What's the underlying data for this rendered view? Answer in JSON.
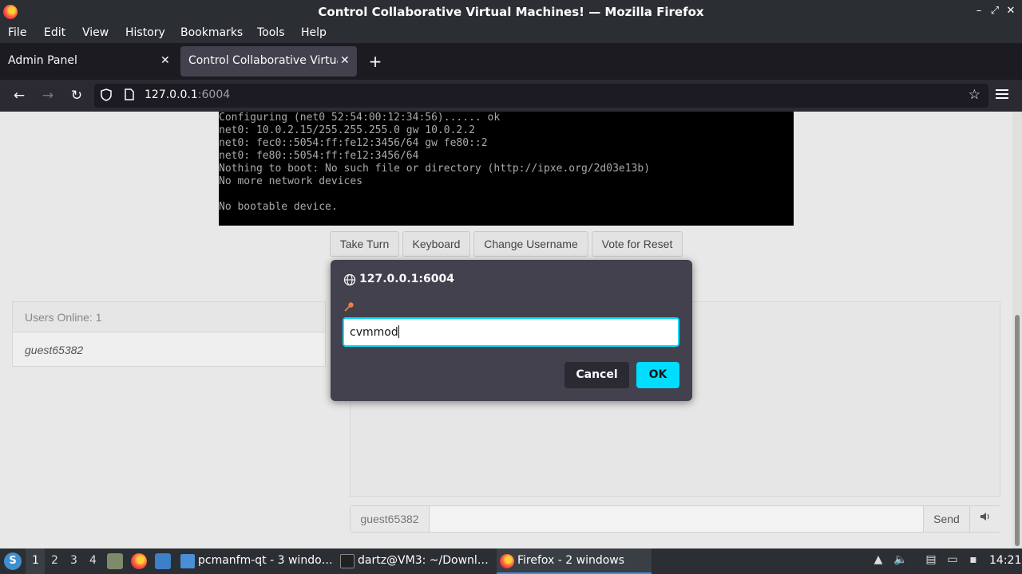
{
  "window": {
    "title": "Control Collaborative Virtual Machines! — Mozilla Firefox",
    "minimize_glyph": "–",
    "maximize_glyph": "⤢",
    "close_glyph": "✕"
  },
  "menu": {
    "items": [
      "File",
      "Edit",
      "View",
      "History",
      "Bookmarks",
      "Tools",
      "Help"
    ]
  },
  "tabs": [
    {
      "label": "Admin Panel",
      "active": false
    },
    {
      "label": "Control Collaborative Virtual Machines!",
      "active": true
    }
  ],
  "tab_close_glyph": "✕",
  "new_tab_glyph": "+",
  "nav": {
    "back_glyph": "←",
    "forward_glyph": "→",
    "reload_glyph": "↻",
    "url_host": "127.0.0.1",
    "url_port": ":6004",
    "icons": [
      "back-arrow-icon",
      "forward-arrow-icon",
      "reload-icon",
      "shield-icon",
      "page-icon",
      "bookmark-star-icon",
      "hamburger-menu-icon"
    ]
  },
  "vm": {
    "console_lines": [
      "Configuring (net0 52:54:00:12:34:56)...... ok",
      "net0: 10.0.2.15/255.255.255.0 gw 10.0.2.2",
      "net0: fec0::5054:ff:fe12:3456/64 gw fe80::2",
      "net0: fe80::5054:ff:fe12:3456/64",
      "Nothing to boot: No such file or directory (http://ipxe.org/2d03e13b)",
      "No more network devices",
      "",
      "No bootable device."
    ],
    "buttons": [
      "Take Turn",
      "Keyboard",
      "Change Username",
      "Vote for Reset"
    ]
  },
  "users": {
    "header": "Users Online: 1",
    "list": [
      "guest65382"
    ]
  },
  "chat": {
    "username": "guest65382",
    "message_value": "",
    "send_label": "Send",
    "volume_icon": "speaker-icon"
  },
  "dialog": {
    "origin": "127.0.0.1:6004",
    "input_value": "cvmmod",
    "cancel_label": "Cancel",
    "ok_label": "OK",
    "accent": "#00ddff",
    "icons": [
      "globe-icon",
      "key-icon"
    ]
  },
  "taskbar": {
    "workspaces": [
      "1",
      "2",
      "3",
      "4"
    ],
    "active_workspace": "1",
    "tasks": [
      {
        "label": "pcmanfm-qt - 3 windo…",
        "icon": "folder-icon"
      },
      {
        "label": "dartz@VM3: ~/Downl…",
        "icon": "terminal-icon"
      },
      {
        "label": "Firefox - 2 windows",
        "icon": "firefox-icon",
        "active": true
      }
    ],
    "clock": "14:21"
  },
  "colors": {
    "chrome_dark": "#2b2e33",
    "tab_active": "#42414d",
    "dialog_bg": "#42414d",
    "ok_button": "#00ddff",
    "taskbar_accent": "#3d8fd1"
  }
}
